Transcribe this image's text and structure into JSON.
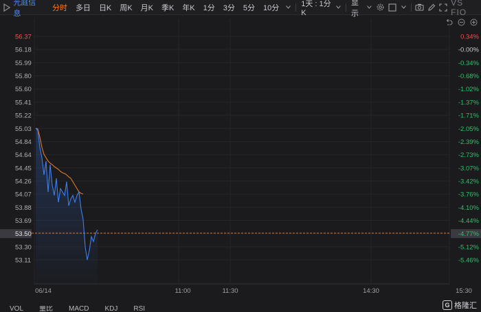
{
  "toolbar": {
    "stock_name": "光庭信息",
    "tabs": [
      "分时",
      "多日",
      "日K",
      "周K",
      "月K",
      "季K",
      "年K",
      "1分",
      "3分",
      "5分",
      "10分"
    ],
    "active_tab": "分时",
    "period_dropdown": "1天 : 1分K",
    "display_dropdown": "显示",
    "vs_label": "VS FIO",
    "icons": [
      "gear-icon",
      "checkbox-icon",
      "camera-icon",
      "edit-icon",
      "expand-icon"
    ]
  },
  "mini_icons": [
    "undo-icon",
    "minus-icon",
    "plus-icon"
  ],
  "colors": {
    "price_line": "#3d7ff0",
    "avg_line": "#e07a2e",
    "up": "#ff4a4a",
    "down": "#2cc26a",
    "dashed": "#e07a2e"
  },
  "chart_data": {
    "type": "line",
    "left_axis": [
      "56.37",
      "56.18",
      "55.99",
      "55.80",
      "55.60",
      "55.41",
      "55.22",
      "55.03",
      "54.84",
      "54.64",
      "54.45",
      "54.26",
      "54.07",
      "53.88",
      "53.69",
      "53.50",
      "53.30",
      "53.11"
    ],
    "right_axis": [
      "0.34%",
      "-0.00%",
      "-0.34%",
      "-0.68%",
      "-1.02%",
      "-1.37%",
      "-1.71%",
      "-2.05%",
      "-2.39%",
      "-2.73%",
      "-3.07%",
      "-3.42%",
      "-3.76%",
      "-4.10%",
      "-4.44%",
      "-4.77%",
      "-5.12%",
      "-5.46%"
    ],
    "highlight_price": "53.50",
    "highlight_percent": "-4.77%",
    "x_labels": [
      "06/14",
      "11:00",
      "11:30",
      "14:30",
      "15:30"
    ],
    "price_series": [
      55.03,
      55.0,
      54.75,
      54.6,
      54.35,
      54.55,
      54.1,
      54.5,
      54.2,
      54.05,
      54.3,
      53.95,
      54.15,
      54.1,
      54.05,
      54.25,
      53.9,
      54.0,
      54.05,
      53.95,
      54.05,
      54.1,
      53.85,
      53.7,
      53.3,
      53.11,
      53.25,
      53.45,
      53.38,
      53.5,
      53.55
    ],
    "avg_series": [
      55.03,
      55.02,
      54.9,
      54.75,
      54.65,
      54.6,
      54.55,
      54.52,
      54.5,
      54.47,
      54.45,
      54.43,
      54.4,
      54.38,
      54.37,
      54.35,
      54.32,
      54.3,
      54.25,
      54.2,
      54.15,
      54.1,
      54.08,
      54.07
    ]
  },
  "bottom_tabs": [
    "VOL",
    "量比",
    "MACD",
    "KDJ",
    "RSI"
  ],
  "brand": "格隆汇",
  "brand_mark": "G"
}
